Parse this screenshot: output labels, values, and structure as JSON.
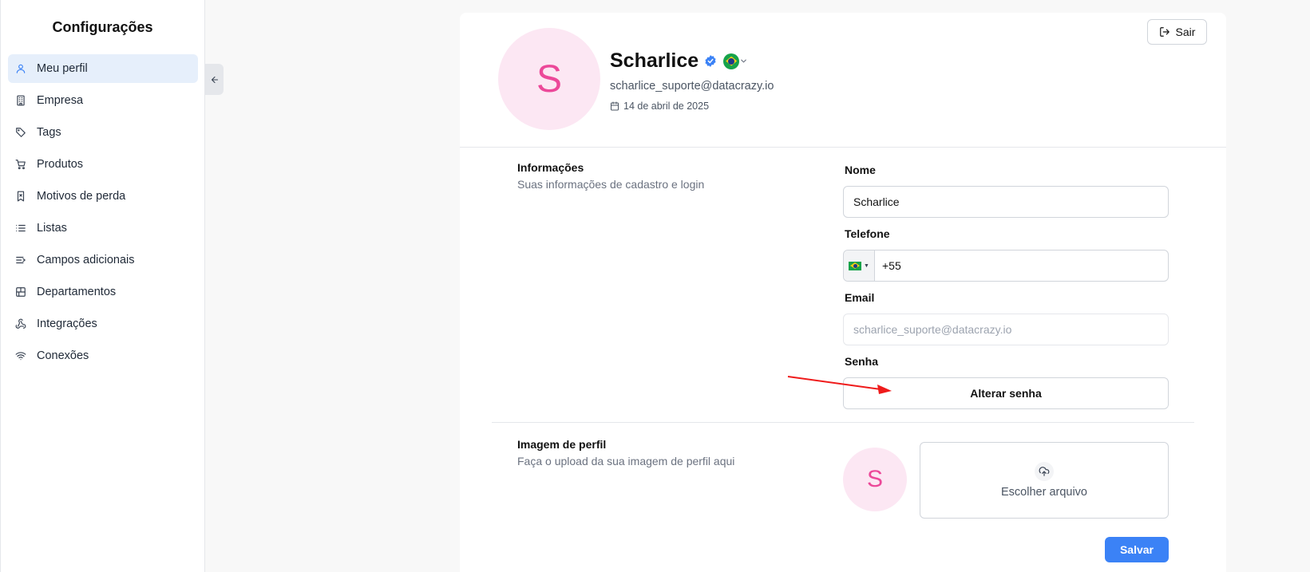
{
  "sidebar": {
    "title": "Configurações",
    "items": [
      {
        "label": "Meu perfil",
        "icon": "user-icon",
        "active": true
      },
      {
        "label": "Empresa",
        "icon": "building-icon"
      },
      {
        "label": "Tags",
        "icon": "tag-icon"
      },
      {
        "label": "Produtos",
        "icon": "cart-icon"
      },
      {
        "label": "Motivos de perda",
        "icon": "bookmark-x-icon"
      },
      {
        "label": "Listas",
        "icon": "list-icon"
      },
      {
        "label": "Campos adicionais",
        "icon": "fields-icon"
      },
      {
        "label": "Departamentos",
        "icon": "departments-icon"
      },
      {
        "label": "Integrações",
        "icon": "webhook-icon"
      },
      {
        "label": "Conexões",
        "icon": "wifi-icon"
      }
    ]
  },
  "profile": {
    "initial": "S",
    "name": "Scharlice",
    "email": "scharlice_suporte@datacrazy.io",
    "date": "14 de abril de 2025",
    "logout_label": "Sair"
  },
  "info_section": {
    "title": "Informações",
    "description": "Suas informações de cadastro e login"
  },
  "form": {
    "name_label": "Nome",
    "name_value": "Scharlice",
    "phone_label": "Telefone",
    "phone_value": "+55",
    "email_label": "Email",
    "email_value": "scharlice_suporte@datacrazy.io",
    "password_label": "Senha",
    "change_password_label": "Alterar senha"
  },
  "image_section": {
    "title": "Imagem de perfil",
    "description": "Faça o upload da sua imagem de perfil aqui",
    "initial": "S",
    "upload_label": "Escolher arquivo"
  },
  "save_label": "Salvar",
  "colors": {
    "accent": "#3b82f6",
    "avatar_bg": "#fce7f3",
    "avatar_text": "#ec4899",
    "annotation_arrow": "#ef1b1b"
  }
}
